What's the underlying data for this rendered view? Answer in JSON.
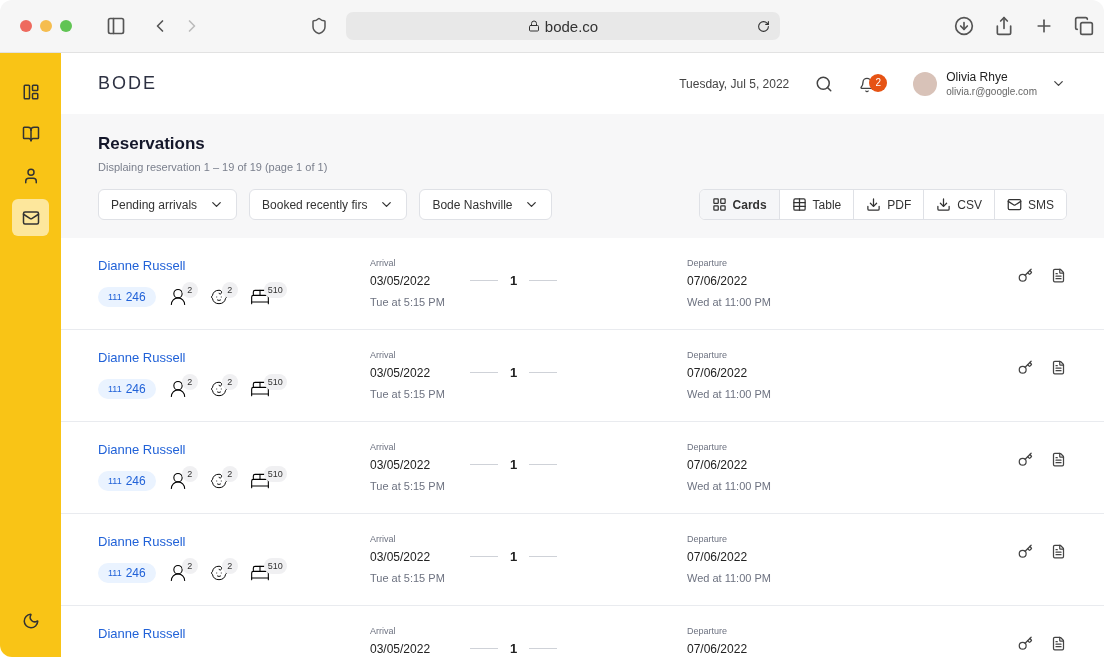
{
  "browser": {
    "url": "bode.co"
  },
  "sidebar": {
    "items": [
      {
        "kind": "layout",
        "selected": false
      },
      {
        "kind": "book",
        "selected": false
      },
      {
        "kind": "user",
        "selected": false
      },
      {
        "kind": "mail",
        "selected": true
      }
    ]
  },
  "header": {
    "logo": "BODE",
    "date": "Tuesday, Jul 5, 2022",
    "notifications": "2",
    "user": {
      "name": "Olivia Rhye",
      "email": "olivia.r@google.com"
    }
  },
  "page": {
    "title": "Reservations",
    "subtitle": "Displaing reservation 1 – 19 of 19 (page 1 of 1)",
    "filters": [
      "Pending arrivals",
      "Booked recently firs",
      "Bode Nashville"
    ],
    "views": [
      {
        "kind": "cards",
        "label": "Cards",
        "selected": true
      },
      {
        "kind": "table",
        "label": "Table",
        "selected": false
      },
      {
        "kind": "download",
        "label": "PDF",
        "selected": false
      },
      {
        "kind": "download",
        "label": "CSV",
        "selected": false
      },
      {
        "kind": "mail",
        "label": "SMS",
        "selected": false
      }
    ]
  },
  "reservations": [
    {
      "guest": "Dianne Russell",
      "code_prefix": "111",
      "code": "246",
      "adults": "2",
      "children": "2",
      "room": "510",
      "arrival_label": "Arrival",
      "arrival_date": "03/05/2022",
      "arrival_time": "Tue at 5:15 PM",
      "nights": "1",
      "departure_label": "Departure",
      "departure_date": "07/06/2022",
      "departure_time": "Wed at 11:00 PM"
    },
    {
      "guest": "Dianne Russell",
      "code_prefix": "111",
      "code": "246",
      "adults": "2",
      "children": "2",
      "room": "510",
      "arrival_label": "Arrival",
      "arrival_date": "03/05/2022",
      "arrival_time": "Tue at 5:15 PM",
      "nights": "1",
      "departure_label": "Departure",
      "departure_date": "07/06/2022",
      "departure_time": "Wed at 11:00 PM"
    },
    {
      "guest": "Dianne Russell",
      "code_prefix": "111",
      "code": "246",
      "adults": "2",
      "children": "2",
      "room": "510",
      "arrival_label": "Arrival",
      "arrival_date": "03/05/2022",
      "arrival_time": "Tue at 5:15 PM",
      "nights": "1",
      "departure_label": "Departure",
      "departure_date": "07/06/2022",
      "departure_time": "Wed at 11:00 PM"
    },
    {
      "guest": "Dianne Russell",
      "code_prefix": "111",
      "code": "246",
      "adults": "2",
      "children": "2",
      "room": "510",
      "arrival_label": "Arrival",
      "arrival_date": "03/05/2022",
      "arrival_time": "Tue at 5:15 PM",
      "nights": "1",
      "departure_label": "Departure",
      "departure_date": "07/06/2022",
      "departure_time": "Wed at 11:00 PM"
    },
    {
      "guest": "Dianne Russell",
      "arrival_label": "Arrival",
      "arrival_date": "03/05/2022",
      "nights": "1",
      "departure_label": "Departure",
      "departure_date": "07/06/2022"
    }
  ]
}
